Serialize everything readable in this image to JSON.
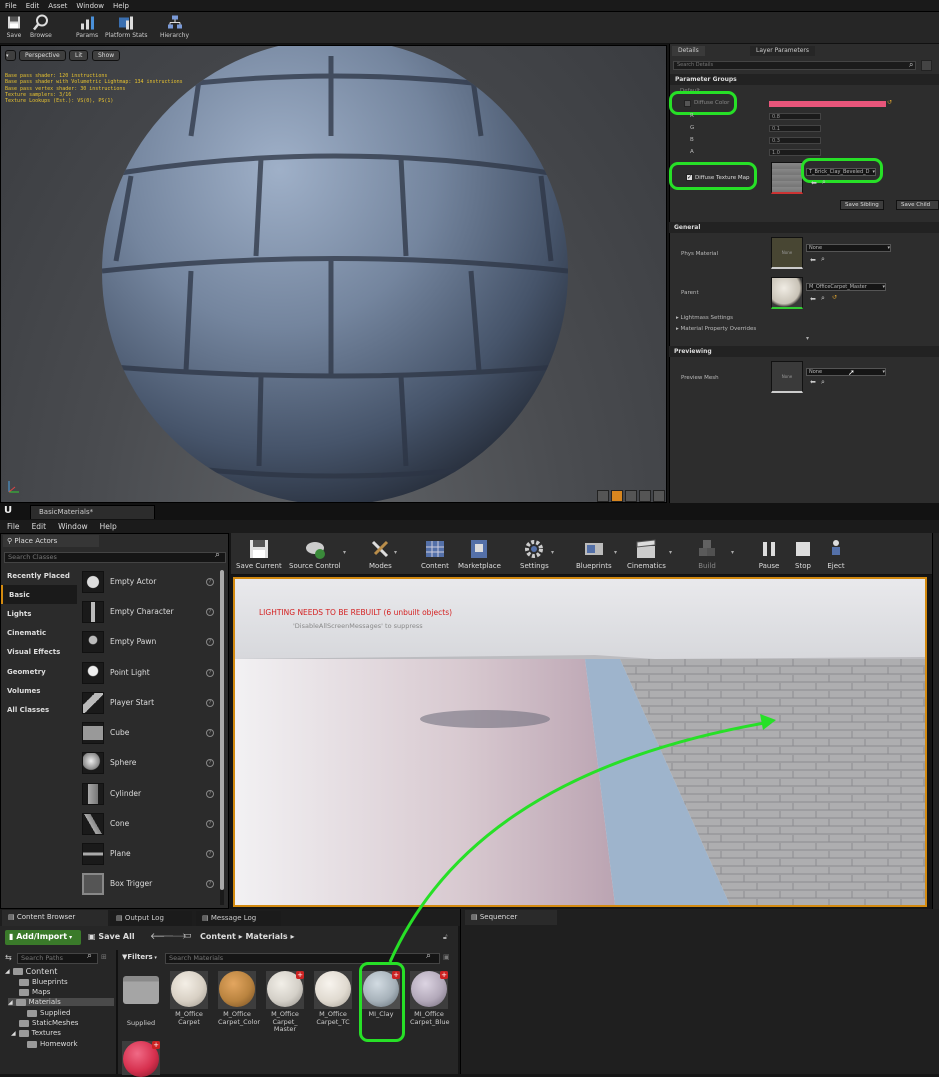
{
  "top_editor": {
    "menu": [
      "File",
      "Edit",
      "Asset",
      "Window",
      "Help"
    ],
    "toolbar": [
      "Save",
      "Browse",
      "Params",
      "Platform Stats",
      "Hierarchy"
    ],
    "viewport": {
      "buttons": [
        "Perspective",
        "Lit",
        "Show"
      ],
      "stats": [
        "Base pass shader: 120 instructions",
        "Base pass shader with Volumetric Lightmap: 134 instructions",
        "Base pass vertex shader: 30 instructions",
        "Texture samplers: 3/16",
        "Texture Lookups (Est.): VS(0), PS(1)"
      ]
    },
    "details": {
      "tabs": [
        "Details",
        "Layer Parameters"
      ],
      "search_placeholder": "Search Details",
      "sections": {
        "parameter_groups": "Parameter Groups",
        "general": "General",
        "previewing": "Previewing"
      },
      "default_group": "Default",
      "diffuse_color_label": "Diffuse Color",
      "diffuse_color_hex": "#e8557a",
      "channels": [
        {
          "name": "R",
          "value": "0.8"
        },
        {
          "name": "G",
          "value": "0.1"
        },
        {
          "name": "B",
          "value": "0.3"
        },
        {
          "name": "A",
          "value": "1.0"
        }
      ],
      "diffuse_texture_label": "Diffuse Texture Map",
      "diffuse_texture_value": "T_Brick_Clay_Beveled_D",
      "save_sibling": "Save Sibling",
      "save_child": "Save Child",
      "phys_material_label": "Phys Material",
      "phys_material_value": "None",
      "phys_material_thumb": "None",
      "parent_label": "Parent",
      "parent_value": "M_OfficeCarpet_Master",
      "lightmass_settings": "Lightmass Settings",
      "material_property_overrides": "Material Property Overrides",
      "preview_mesh_label": "Preview Mesh",
      "preview_mesh_value": "None",
      "preview_mesh_thumb": "None"
    }
  },
  "editor": {
    "tab_title": "BasicMaterials*",
    "menu": [
      "File",
      "Edit",
      "Window",
      "Help"
    ],
    "place_actors": {
      "title": "Place Actors",
      "search_placeholder": "Search Classes",
      "categories": [
        "Recently Placed",
        "Basic",
        "Lights",
        "Cinematic",
        "Visual Effects",
        "Geometry",
        "Volumes",
        "All Classes"
      ],
      "items": [
        "Empty Actor",
        "Empty Character",
        "Empty Pawn",
        "Point Light",
        "Player Start",
        "Cube",
        "Sphere",
        "Cylinder",
        "Cone",
        "Plane",
        "Box Trigger"
      ]
    },
    "toolbar": [
      "Save Current",
      "Source Control",
      "Modes",
      "Content",
      "Marketplace",
      "Settings",
      "Blueprints",
      "Cinematics",
      "Build",
      "Pause",
      "Stop",
      "Eject"
    ],
    "viewport": {
      "warning": "LIGHTING NEEDS TO BE REBUILT (6 unbuilt objects)",
      "suppress": "'DisableAllScreenMessages' to suppress"
    },
    "bottom_tabs": [
      "Content Browser",
      "Output Log",
      "Message Log",
      "Sequencer"
    ],
    "content_browser": {
      "add_import": "Add/Import",
      "save_all": "Save All",
      "path": [
        "Content",
        "Materials"
      ],
      "search_paths_placeholder": "Search Paths",
      "filters": "Filters",
      "search_materials_placeholder": "Search Materials",
      "tree": [
        "Content",
        "Blueprints",
        "Maps",
        "Materials",
        "Supplied",
        "StaticMeshes",
        "Textures",
        "Homework"
      ],
      "assets": [
        {
          "name": "Supplied",
          "kind": "folder"
        },
        {
          "name": "M_Office Carpet",
          "color": "#d8d0c4"
        },
        {
          "name": "M_Office Carpet_Color",
          "color": "#b9833f"
        },
        {
          "name": "M_Office Carpet_ Master",
          "color": "#d4d0c8"
        },
        {
          "name": "M_Office Carpet_TC",
          "color": "#e0dad0"
        },
        {
          "name": "MI_Clay",
          "color": "#a7b2ba"
        },
        {
          "name": "MI_Office Carpet_Blue",
          "color": "#b3a9ba"
        }
      ]
    }
  }
}
